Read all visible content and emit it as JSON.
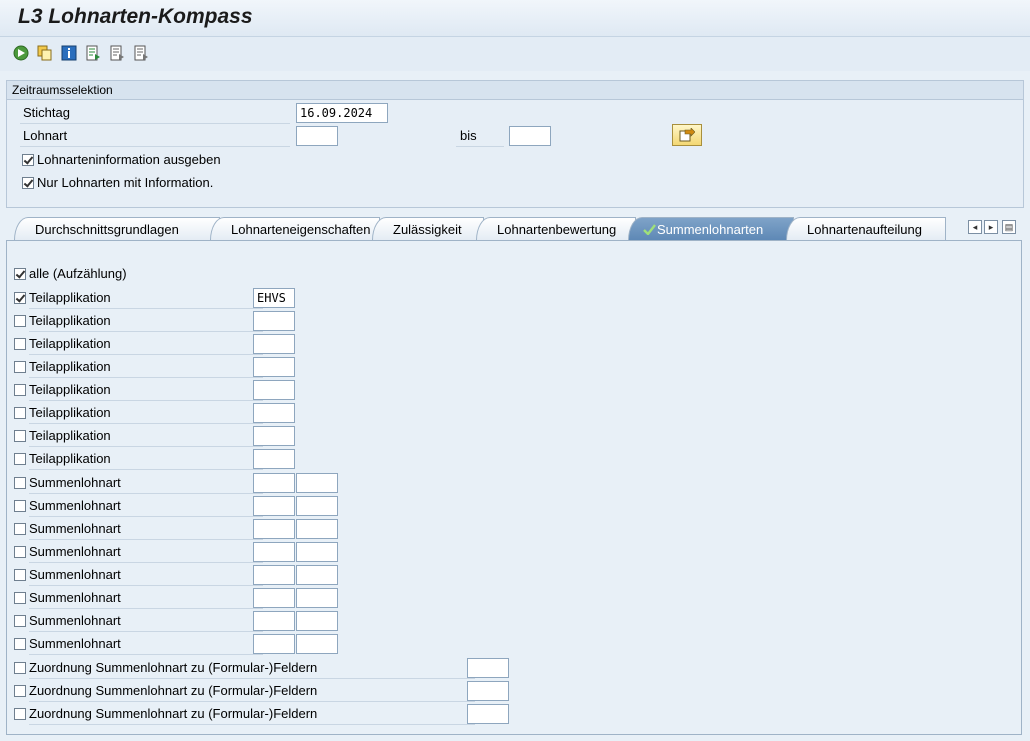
{
  "title": "L3 Lohnarten-Kompass",
  "toolbar": {
    "icons": [
      "execute-icon",
      "copy-icon",
      "info-icon",
      "export-icon",
      "export2-icon",
      "export3-icon"
    ]
  },
  "selection": {
    "group_title": "Zeitraumsselektion",
    "stichtag_label": "Stichtag",
    "stichtag_value": "16.09.2024",
    "lohnart_label": "Lohnart",
    "lohnart_from": "",
    "bis_label": "bis",
    "lohnart_to": "",
    "chk_info_label": "Lohnarteninformation ausgeben",
    "chk_info_checked": true,
    "chk_only_label": "Nur Lohnarten mit Information.",
    "chk_only_checked": true
  },
  "tabs": [
    {
      "label": "Durchschnittsgrundlagen",
      "active": false
    },
    {
      "label": "Lohnarteneigenschaften",
      "active": false
    },
    {
      "label": "Zulässigkeit",
      "active": false
    },
    {
      "label": "Lohnartenbewertung",
      "active": false
    },
    {
      "label": "Summenlohnarten",
      "active": true
    },
    {
      "label": "Lohnartenaufteilung",
      "active": false
    }
  ],
  "panel": {
    "alle_label": "alle (Aufzählung)",
    "alle_checked": true,
    "teilapplikation": [
      {
        "label": "Teilapplikation",
        "checked": true,
        "value": "EHVS"
      },
      {
        "label": "Teilapplikation",
        "checked": false,
        "value": ""
      },
      {
        "label": "Teilapplikation",
        "checked": false,
        "value": ""
      },
      {
        "label": "Teilapplikation",
        "checked": false,
        "value": ""
      },
      {
        "label": "Teilapplikation",
        "checked": false,
        "value": ""
      },
      {
        "label": "Teilapplikation",
        "checked": false,
        "value": ""
      },
      {
        "label": "Teilapplikation",
        "checked": false,
        "value": ""
      },
      {
        "label": "Teilapplikation",
        "checked": false,
        "value": ""
      }
    ],
    "summenlohnart": [
      {
        "label": "Summenlohnart",
        "checked": false,
        "value1": "",
        "value2": ""
      },
      {
        "label": "Summenlohnart",
        "checked": false,
        "value1": "",
        "value2": ""
      },
      {
        "label": "Summenlohnart",
        "checked": false,
        "value1": "",
        "value2": ""
      },
      {
        "label": "Summenlohnart",
        "checked": false,
        "value1": "",
        "value2": ""
      },
      {
        "label": "Summenlohnart",
        "checked": false,
        "value1": "",
        "value2": ""
      },
      {
        "label": "Summenlohnart",
        "checked": false,
        "value1": "",
        "value2": ""
      },
      {
        "label": "Summenlohnart",
        "checked": false,
        "value1": "",
        "value2": ""
      },
      {
        "label": "Summenlohnart",
        "checked": false,
        "value1": "",
        "value2": ""
      }
    ],
    "zuordnung": [
      {
        "label": "Zuordnung Summenlohnart zu (Formular-)Feldern",
        "checked": false,
        "value": ""
      },
      {
        "label": "Zuordnung Summenlohnart zu (Formular-)Feldern",
        "checked": false,
        "value": ""
      },
      {
        "label": "Zuordnung Summenlohnart zu (Formular-)Feldern",
        "checked": false,
        "value": ""
      }
    ]
  }
}
